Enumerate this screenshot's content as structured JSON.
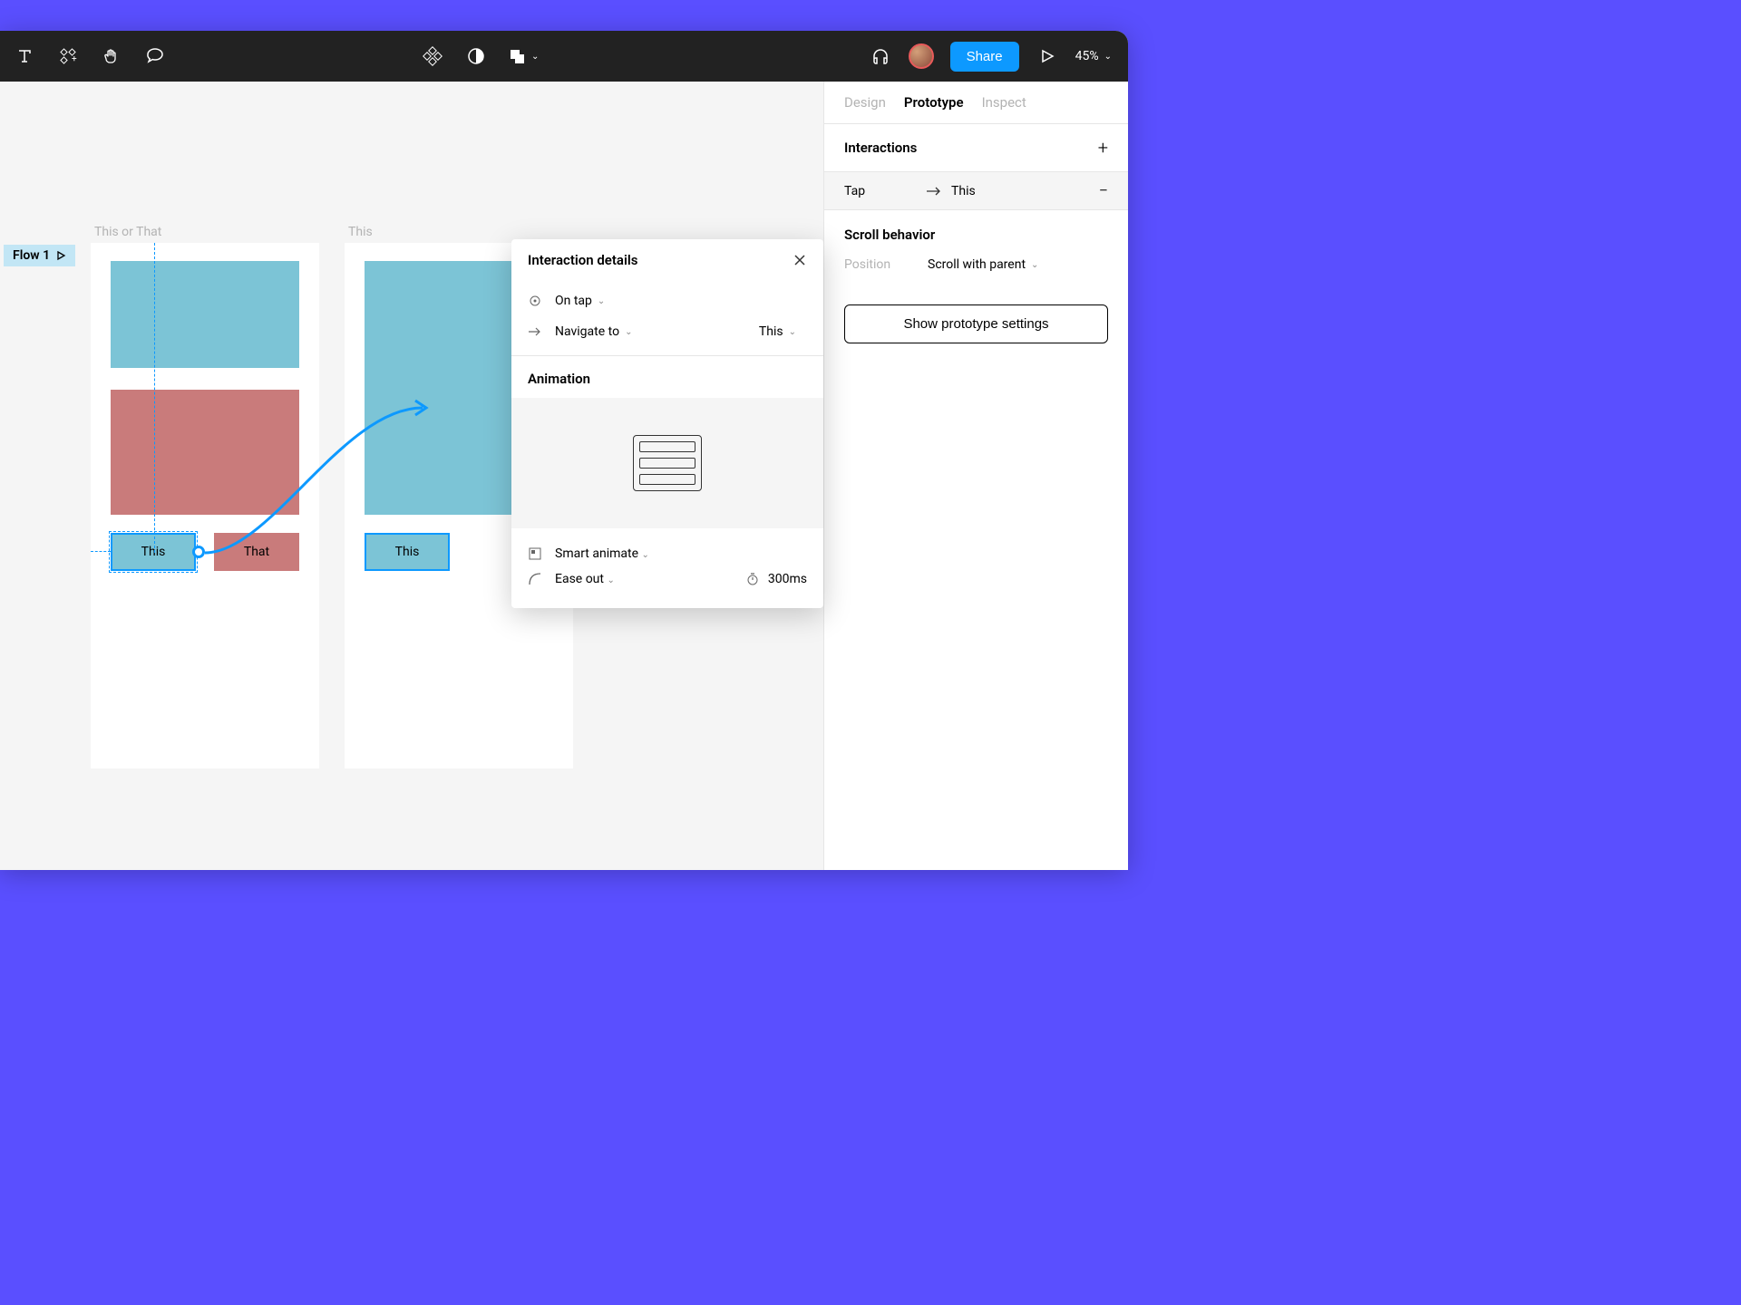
{
  "toolbar": {
    "share_label": "Share",
    "zoom": "45%"
  },
  "tabs": {
    "design": "Design",
    "prototype": "Prototype",
    "inspect": "Inspect"
  },
  "interactions": {
    "header": "Interactions",
    "row": {
      "trigger": "Tap",
      "target": "This"
    }
  },
  "scroll": {
    "header": "Scroll behavior",
    "position_label": "Position",
    "position_value": "Scroll with parent"
  },
  "proto_settings_label": "Show prototype settings",
  "interaction_panel": {
    "title": "Interaction details",
    "trigger_label": "On tap",
    "action_label": "Navigate to",
    "action_target": "This",
    "animation_header": "Animation",
    "anim_type": "Smart animate",
    "easing": "Ease out",
    "duration": "300ms"
  },
  "canvas": {
    "flow_label": "Flow 1",
    "frame1_label": "This or That",
    "frame2_label": "This",
    "btn_this": "This",
    "btn_that": "That",
    "btn_this2": "This"
  }
}
